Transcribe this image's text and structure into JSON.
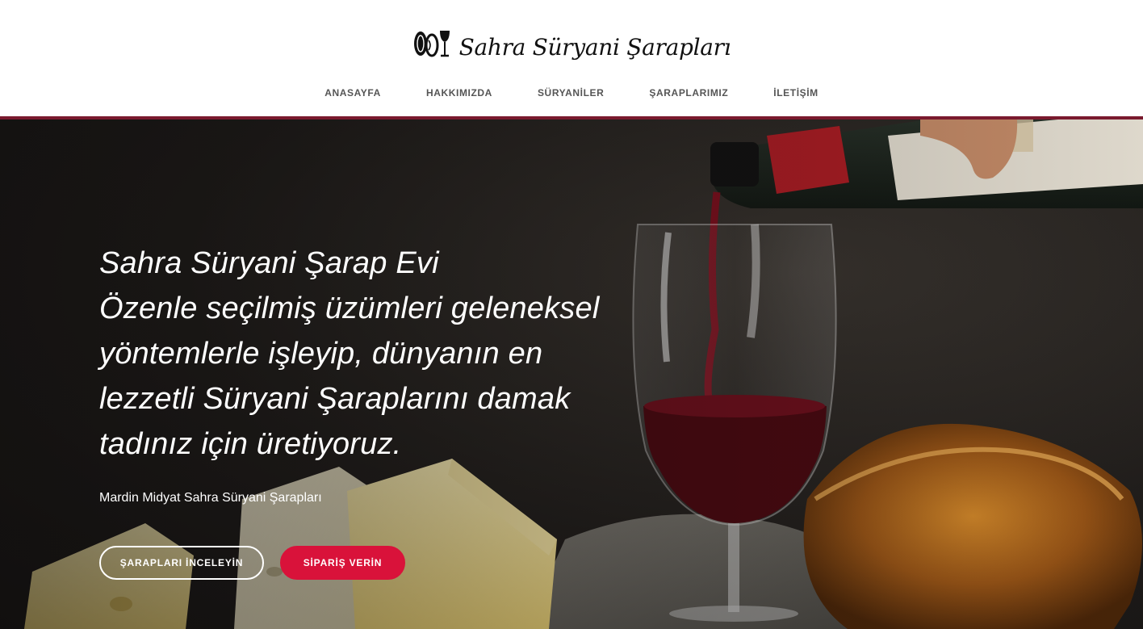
{
  "header": {
    "logo_text": "Sahra Süryani Şarapları",
    "nav": [
      "ANASAYFA",
      "HAKKIMIZDA",
      "SÜRYANİLER",
      "ŞARAPLARIMIZ",
      "İLETİŞİM"
    ]
  },
  "hero": {
    "title": "Sahra Süryani Şarap Evi",
    "lead": "Özenle seçilmiş üzümleri geleneksel yöntemlerle işleyip, dünyanın en lezzetli Süryani Şaraplarını damak tadınız için üretiyoruz.",
    "subtitle": "Mardin Midyat Sahra Süryani Şarapları",
    "buttons": {
      "browse": "ŞARAPLARI İNCELEYİN",
      "order": "SİPARİŞ VERİN"
    }
  },
  "colors": {
    "accent_border": "#7a1a2e",
    "order_button": "#d9123a",
    "nav_text": "#555555"
  },
  "icons": [
    "logo-mark-icon"
  ]
}
